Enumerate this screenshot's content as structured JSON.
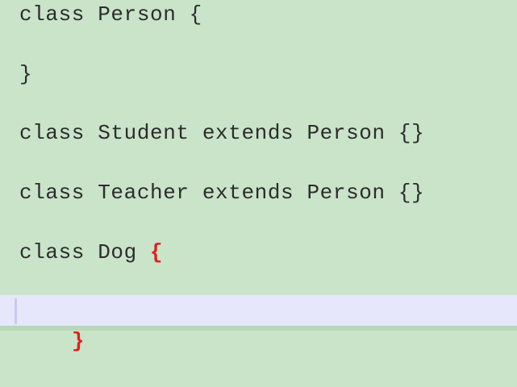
{
  "editor": {
    "lines": [
      "class Person {",
      "}",
      "class Student extends Person {}",
      "class Teacher extends Person {}",
      "class Dog ",
      ""
    ],
    "highlight": {
      "open_brace": "{",
      "close_brace": "}"
    },
    "colors": {
      "background": "#c9e4c9",
      "current_line": "#e6e7fb",
      "text": "#2c2c2c",
      "brace_match": "#e01e1e"
    }
  }
}
